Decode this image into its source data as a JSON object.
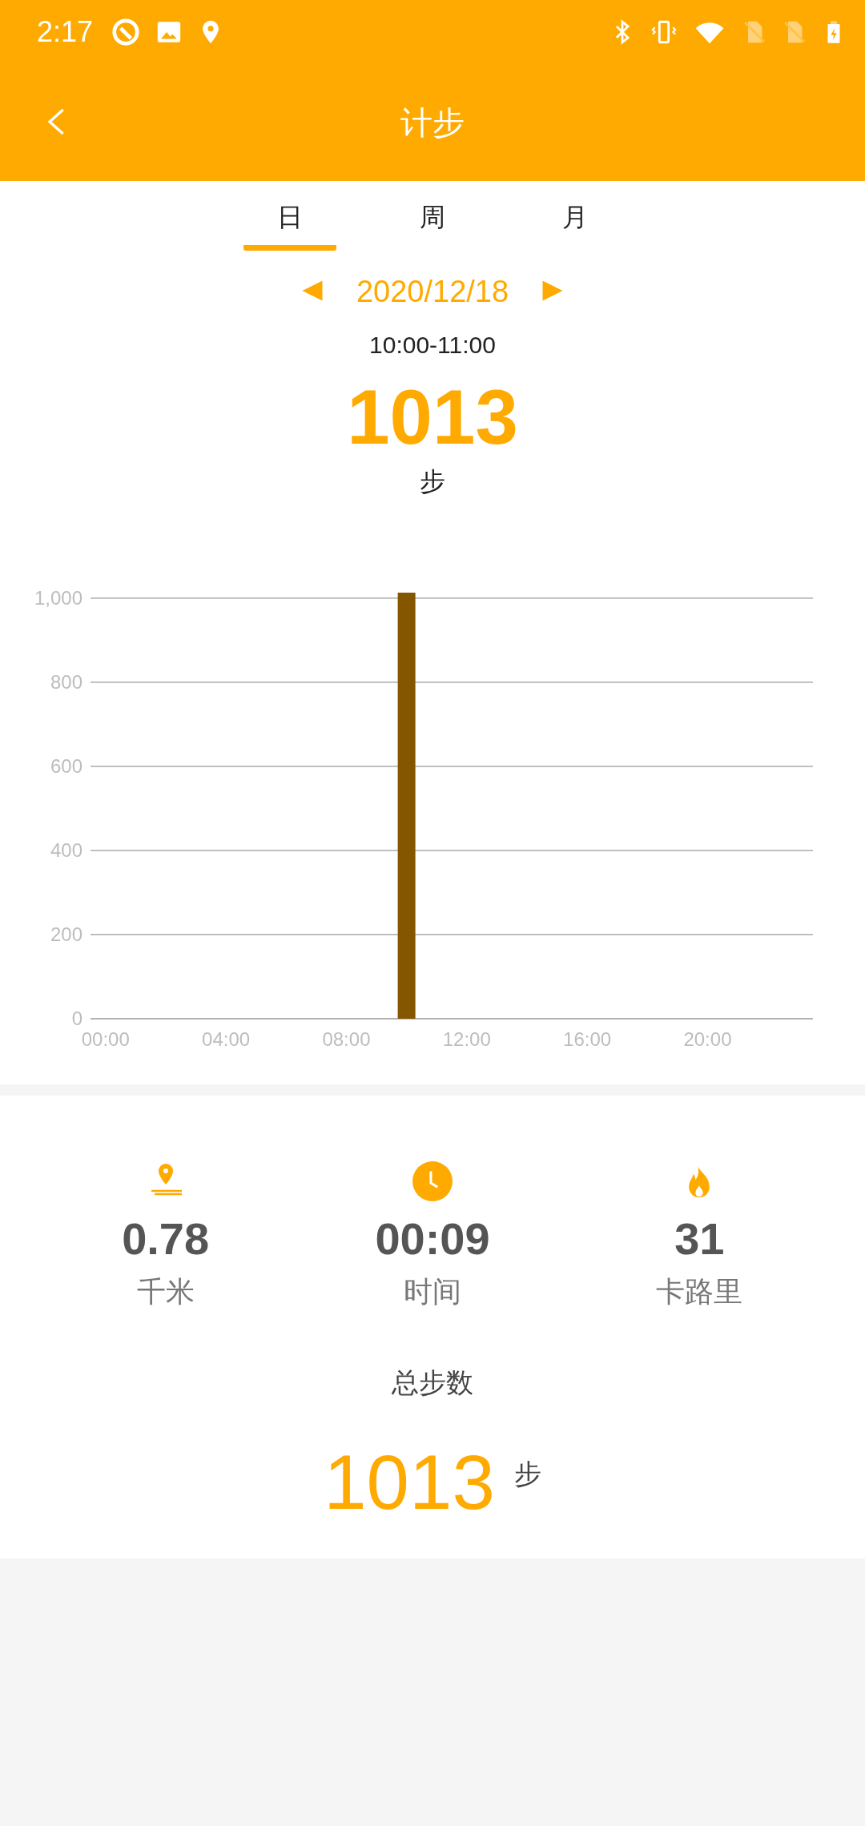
{
  "status_bar": {
    "time": "2:17"
  },
  "header": {
    "title": "计步"
  },
  "tabs": [
    {
      "label": "日",
      "selected": true
    },
    {
      "label": "周",
      "selected": false
    },
    {
      "label": "月",
      "selected": false
    }
  ],
  "date_nav": {
    "date": "2020/12/18"
  },
  "selection": {
    "range": "10:00-11:00",
    "steps": "1013",
    "unit": "步"
  },
  "chart": {
    "chart_data": {
      "type": "bar",
      "x": [
        0,
        1,
        2,
        3,
        4,
        5,
        6,
        7,
        8,
        9,
        10,
        11,
        12,
        13,
        14,
        15,
        16,
        17,
        18,
        19,
        20,
        21,
        22,
        23
      ],
      "series": [
        {
          "color": "#845600",
          "values": [
            0,
            0,
            0,
            0,
            0,
            0,
            0,
            0,
            0,
            0,
            1013,
            0,
            0,
            0,
            0,
            0,
            0,
            0,
            0,
            0,
            0,
            0,
            0,
            0
          ]
        }
      ],
      "xlim": [
        -0.5,
        23.5
      ],
      "ylim": [
        0,
        1013
      ],
      "grid": true,
      "yticks": [
        {
          "value": 0,
          "label": "0"
        },
        {
          "value": 200,
          "label": "200"
        },
        {
          "value": 400,
          "label": "400"
        },
        {
          "value": 600,
          "label": "600"
        },
        {
          "value": 800,
          "label": "800"
        },
        {
          "value": 1000,
          "label": "1,000"
        }
      ],
      "xticks": [
        {
          "value": 0,
          "label": "00:00"
        },
        {
          "value": 4,
          "label": "04:00"
        },
        {
          "value": 8,
          "label": "08:00"
        },
        {
          "value": 12,
          "label": "12:00"
        },
        {
          "value": 16,
          "label": "16:00"
        },
        {
          "value": 20,
          "label": "20:00"
        }
      ]
    }
  },
  "stats": [
    {
      "kind": "distance",
      "value": "0.78",
      "label": "千米"
    },
    {
      "kind": "time",
      "value": "00:09",
      "label": "时间"
    },
    {
      "kind": "calories",
      "value": "31",
      "label": "卡路里"
    }
  ],
  "total": {
    "label": "总步数",
    "steps": "1013",
    "unit": "步"
  }
}
